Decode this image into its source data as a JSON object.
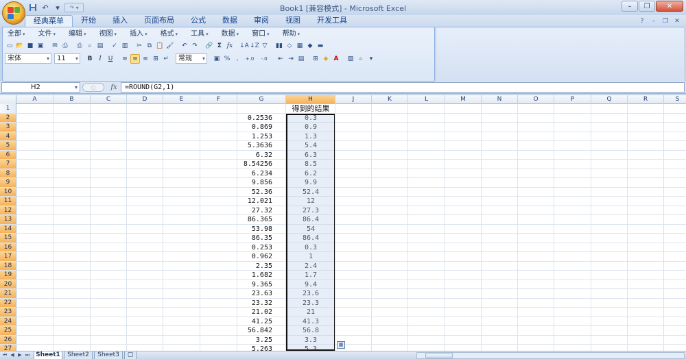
{
  "window": {
    "title": "Book1  [兼容模式] - Microsoft Excel",
    "buttons": {
      "minimize": "–",
      "restore": "❐",
      "close": "✕"
    }
  },
  "quick_access": {
    "icons": [
      "save-icon",
      "undo-icon",
      "redo-icon"
    ]
  },
  "ribbon_tabs": [
    {
      "label": "经典菜单",
      "active": true
    },
    {
      "label": "开始",
      "active": false
    },
    {
      "label": "插入",
      "active": false
    },
    {
      "label": "页面布局",
      "active": false
    },
    {
      "label": "公式",
      "active": false
    },
    {
      "label": "数据",
      "active": false
    },
    {
      "label": "审阅",
      "active": false
    },
    {
      "label": "视图",
      "active": false
    },
    {
      "label": "开发工具",
      "active": false
    }
  ],
  "classic_menu": [
    "全部",
    "文件",
    "编辑",
    "视图",
    "插入",
    "格式",
    "工具",
    "数据",
    "窗口",
    "帮助"
  ],
  "font": {
    "name": "宋体",
    "size": "11",
    "number_format": "常规"
  },
  "formatting": {
    "bold": "B",
    "italic": "I",
    "underline": "U",
    "percent": "%",
    "comma": ",",
    "dec_inc": ".00→.0",
    "dec_dec": ".0→.00"
  },
  "formula_bar": {
    "cell_ref": "H2",
    "fx": "fx",
    "formula": "=ROUND(G2,1)"
  },
  "columns": [
    "A",
    "B",
    "C",
    "D",
    "E",
    "F",
    "G",
    "H",
    "J",
    "K",
    "L",
    "M",
    "N",
    "O",
    "P",
    "Q",
    "R",
    "S"
  ],
  "selected_column": "H",
  "header_h1": "得到的结果",
  "rows": [
    {
      "n": "1",
      "g": "",
      "h": ""
    },
    {
      "n": "2",
      "g": "0.2536",
      "h": "0.3"
    },
    {
      "n": "3",
      "g": "0.869",
      "h": "0.9"
    },
    {
      "n": "4",
      "g": "1.253",
      "h": "1.3"
    },
    {
      "n": "5",
      "g": "5.3636",
      "h": "5.4"
    },
    {
      "n": "6",
      "g": "6.32",
      "h": "6.3"
    },
    {
      "n": "7",
      "g": "8.54256",
      "h": "8.5"
    },
    {
      "n": "8",
      "g": "6.234",
      "h": "6.2"
    },
    {
      "n": "9",
      "g": "9.856",
      "h": "9.9"
    },
    {
      "n": "10",
      "g": "52.36",
      "h": "52.4"
    },
    {
      "n": "11",
      "g": "12.021",
      "h": "12"
    },
    {
      "n": "12",
      "g": "27.32",
      "h": "27.3"
    },
    {
      "n": "13",
      "g": "86.365",
      "h": "86.4"
    },
    {
      "n": "14",
      "g": "53.98",
      "h": "54"
    },
    {
      "n": "15",
      "g": "86.35",
      "h": "86.4"
    },
    {
      "n": "16",
      "g": "0.253",
      "h": "0.3"
    },
    {
      "n": "17",
      "g": "0.962",
      "h": "1"
    },
    {
      "n": "18",
      "g": "2.35",
      "h": "2.4"
    },
    {
      "n": "19",
      "g": "1.682",
      "h": "1.7"
    },
    {
      "n": "20",
      "g": "9.365",
      "h": "9.4"
    },
    {
      "n": "21",
      "g": "23.63",
      "h": "23.6"
    },
    {
      "n": "22",
      "g": "23.32",
      "h": "23.3"
    },
    {
      "n": "23",
      "g": "21.02",
      "h": "21"
    },
    {
      "n": "24",
      "g": "41.25",
      "h": "41.3"
    },
    {
      "n": "25",
      "g": "56.842",
      "h": "56.8"
    },
    {
      "n": "26",
      "g": "3.25",
      "h": "3.3"
    },
    {
      "n": "27",
      "g": "5.263",
      "h": "5.3"
    }
  ],
  "sheets": [
    {
      "label": "Sheet1",
      "active": true
    },
    {
      "label": "Sheet2",
      "active": false
    },
    {
      "label": "Sheet3",
      "active": false
    }
  ],
  "colors": {
    "accent": "#f6b05a",
    "ribbon_border": "#8db2e3",
    "title_blue": "#15428b"
  }
}
